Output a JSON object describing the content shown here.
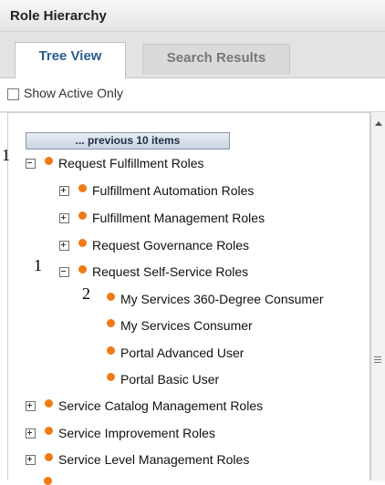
{
  "panel": {
    "title": "Role Hierarchy"
  },
  "tabs": [
    {
      "label": "Tree View"
    },
    {
      "label": "Search Results"
    }
  ],
  "filter": {
    "show_active_label": "Show Active Only",
    "checked": false
  },
  "tree": {
    "previous_label": "... previous 10 items",
    "rows": [
      {
        "label": "Request Fulfillment Roles",
        "expander": "minus"
      },
      {
        "label": "Fulfillment Automation Roles",
        "expander": "plus"
      },
      {
        "label": "Fulfillment Management Roles",
        "expander": "plus"
      },
      {
        "label": "Request Governance Roles",
        "expander": "plus"
      },
      {
        "label": "Request Self-Service Roles",
        "expander": "minus"
      },
      {
        "label": "My Services 360-Degree Consumer",
        "expander": "none"
      },
      {
        "label": "My Services Consumer",
        "expander": "none"
      },
      {
        "label": "Portal Advanced User",
        "expander": "none"
      },
      {
        "label": "Portal Basic User",
        "expander": "none"
      },
      {
        "label": "Service Catalog Management Roles",
        "expander": "plus"
      },
      {
        "label": "Service Improvement Roles",
        "expander": "plus"
      },
      {
        "label": "Service Level Management Roles",
        "expander": "plus"
      }
    ]
  },
  "annotations": {
    "a1": "1",
    "a2": "1",
    "a3": "2"
  },
  "colors": {
    "node_dot": "#f07a14",
    "active_tab_text": "#2b5c8f"
  }
}
